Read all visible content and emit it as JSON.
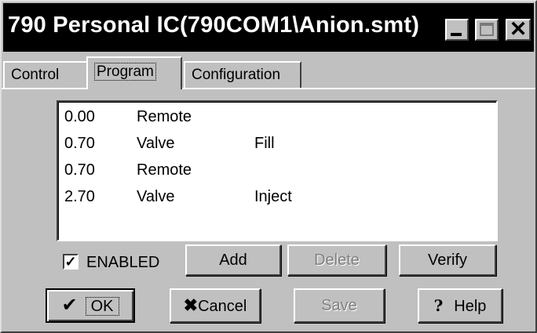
{
  "window": {
    "title": "790 Personal IC(790COM1\\Anion.smt)",
    "close_glyph": "✕"
  },
  "tabs": [
    {
      "label": "Control",
      "active": false
    },
    {
      "label": "Program",
      "active": true
    },
    {
      "label": "Configuration",
      "active": false
    }
  ],
  "program": {
    "rows": [
      {
        "time": "0.00",
        "device": "Remote",
        "action": ""
      },
      {
        "time": "0.70",
        "device": "Valve",
        "action": "Fill"
      },
      {
        "time": "0.70",
        "device": "Remote",
        "action": ""
      },
      {
        "time": "2.70",
        "device": "Valve",
        "action": "Inject"
      }
    ],
    "enabled_label": "ENABLED",
    "enabled_checked": true,
    "check_glyph": "✓",
    "add_label": "Add",
    "delete_label": "Delete",
    "verify_label": "Verify"
  },
  "footer": {
    "ok_label": "OK",
    "ok_icon": "✔",
    "cancel_icon": "✖",
    "cancel_label": "Cancel",
    "save_label": "Save",
    "help_icon": "?",
    "help_label": "Help"
  }
}
